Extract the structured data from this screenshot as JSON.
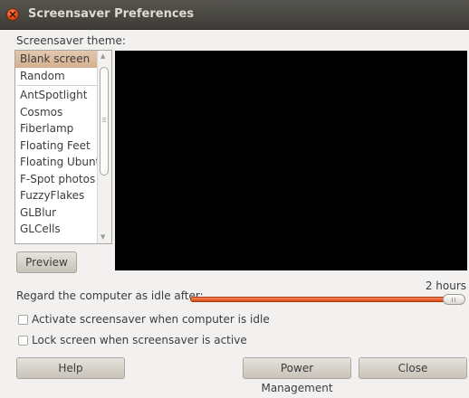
{
  "window": {
    "title": "Screensaver Preferences"
  },
  "theme_label": "Screensaver theme:",
  "themes": [
    {
      "label": "Blank screen",
      "selected": true
    },
    {
      "label": "Random"
    },
    {
      "label": "AntSpotlight"
    },
    {
      "label": "Cosmos"
    },
    {
      "label": "Fiberlamp"
    },
    {
      "label": "Floating Feet"
    },
    {
      "label": "Floating Ubuntu"
    },
    {
      "label": "F-Spot photos"
    },
    {
      "label": "FuzzyFlakes"
    },
    {
      "label": "GLBlur"
    },
    {
      "label": "GLCells"
    }
  ],
  "preview_button": "Preview",
  "idle": {
    "label": "Regard the computer as idle after:",
    "value": "2 hours",
    "slider_fraction": 1.0,
    "accent": "#dd4814"
  },
  "options": {
    "activate_label": "Activate screensaver when computer is idle",
    "activate_checked": false,
    "lock_label": "Lock screen when screensaver is active",
    "lock_checked": false
  },
  "buttons": {
    "help": "Help",
    "power": "Power Management",
    "close": "Close"
  }
}
